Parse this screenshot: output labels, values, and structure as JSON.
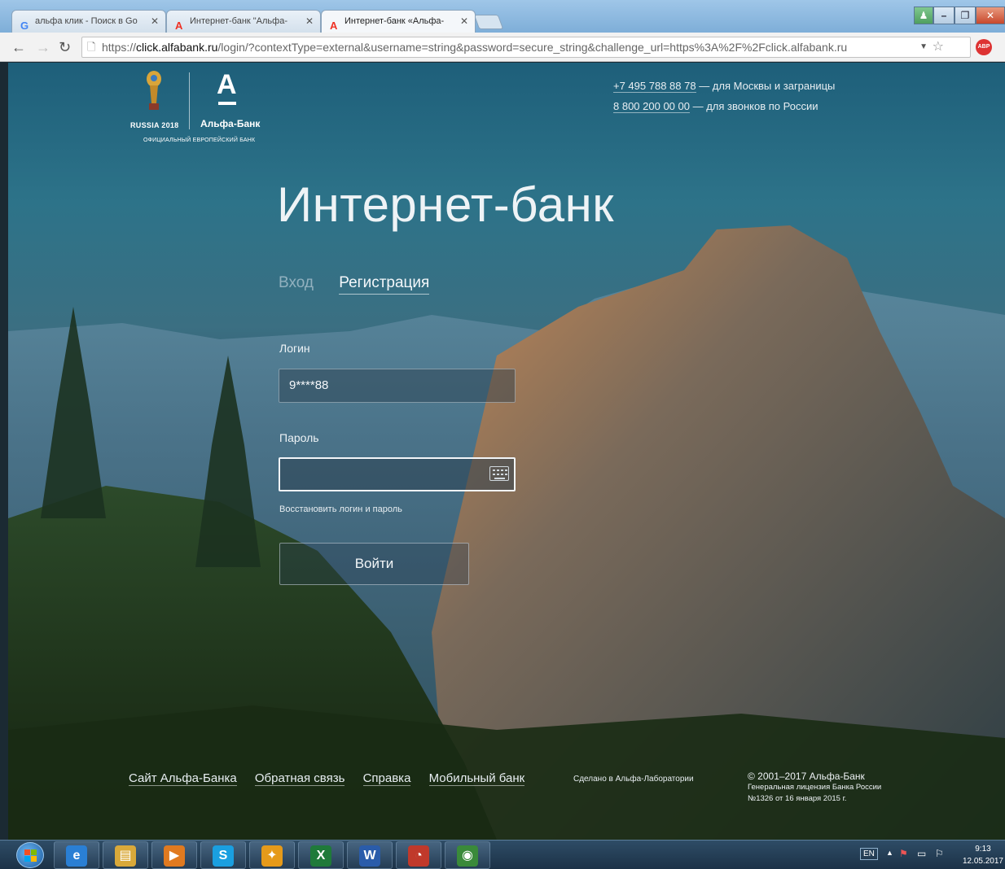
{
  "browser": {
    "tabs": [
      {
        "label": "альфа клик - Поиск в Go",
        "icon": "google-icon"
      },
      {
        "label": "Интернет-банк \"Альфа-",
        "icon": "alfa-icon"
      },
      {
        "label": "Интернет-банк «Альфа-",
        "icon": "alfa-icon"
      }
    ],
    "url_prefix": "https://",
    "url_host": "click.alfabank.ru",
    "url_rest": "/login/?contextType=external&username=string&password=secure_string&challenge_url=https%3A%2F%2Fclick.alfabank.ru",
    "ext_badge": "ABP"
  },
  "page": {
    "logo": {
      "worldcup": "RUSSIA 2018",
      "bank_name": "Альфа-Банк",
      "partner_note": "ОФИЦИАЛЬНЫЙ ЕВРОПЕЙСКИЙ БАНК"
    },
    "phones": [
      {
        "number": "+7 495 788 88 78",
        "note": " — для Москвы и заграницы"
      },
      {
        "number": "8 800 200 00 00",
        "note": " — для звонков по России"
      }
    ],
    "title": "Интернет-банк",
    "auth_tabs": {
      "login": "Вход",
      "register": "Регистрация"
    },
    "login_label": "Логин",
    "login_value": "9****88",
    "password_label": "Пароль",
    "password_value": "",
    "restore_link": "Восстановить логин и пароль",
    "submit": "Войти",
    "footer_links": [
      "Сайт Альфа-Банка",
      "Обратная связь",
      "Справка",
      "Мобильный банк"
    ],
    "lab_note": "Сделано в Альфа-Лаборатории",
    "copyright": "© 2001–2017 Альфа-Банк",
    "license_line1": "Генеральная лицензия Банка России",
    "license_line2": "№1326 от 16 января 2015 г."
  },
  "taskbar": {
    "lang": "EN",
    "time": "9:13",
    "date": "12.05.2017",
    "apps": [
      {
        "name": "ie",
        "glyph": "e",
        "color": "#2a7fd4"
      },
      {
        "name": "explorer",
        "glyph": "▤",
        "color": "#d9a93a"
      },
      {
        "name": "media",
        "glyph": "▶",
        "color": "#e07a20"
      },
      {
        "name": "skype",
        "glyph": "S",
        "color": "#1a9fe0"
      },
      {
        "name": "app-orange",
        "glyph": "✦",
        "color": "#e59a1a"
      },
      {
        "name": "excel",
        "glyph": "X",
        "color": "#1f7a3a"
      },
      {
        "name": "word",
        "glyph": "W",
        "color": "#2a5caa"
      },
      {
        "name": "app-red",
        "glyph": "◔",
        "color": "#c0392b"
      },
      {
        "name": "chrome",
        "glyph": "◉",
        "color": "#3a8a3a"
      }
    ]
  }
}
